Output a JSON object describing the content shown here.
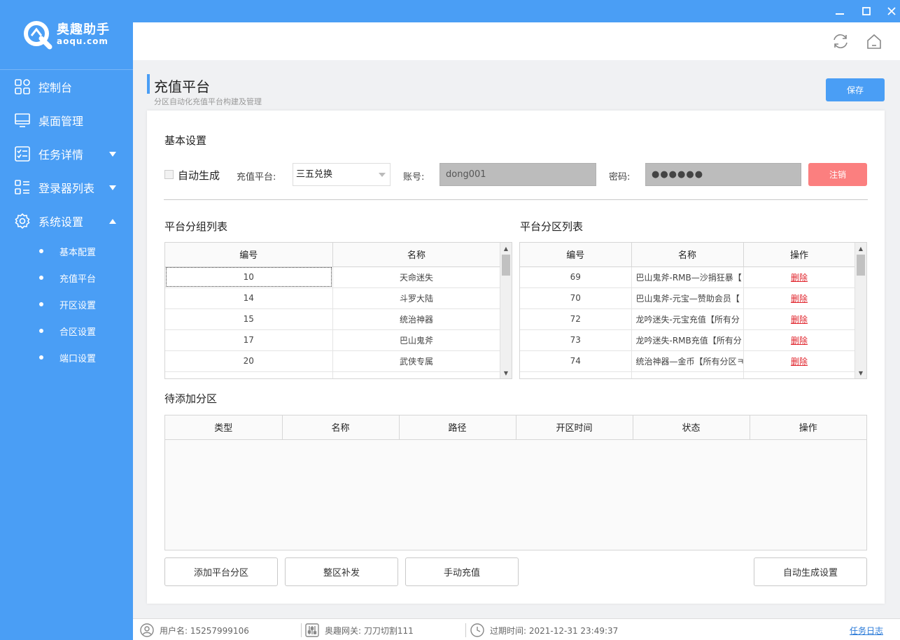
{
  "app": {
    "logo_cn": "奥趣助手",
    "logo_en": "aoqu.com",
    "brand_color": "#4a9ef5"
  },
  "sidebar": {
    "items": [
      {
        "label": "控制台",
        "icon": "grid-icon"
      },
      {
        "label": "桌面管理",
        "icon": "monitor-icon"
      },
      {
        "label": "任务详情",
        "icon": "checklist-icon",
        "expand": "down"
      },
      {
        "label": "登录器列表",
        "icon": "list-icon",
        "expand": "down"
      },
      {
        "label": "系统设置",
        "icon": "gear-icon",
        "expand": "up"
      }
    ],
    "sub_items": [
      "基本配置",
      "充值平台",
      "开区设置",
      "合区设置",
      "端口设置"
    ]
  },
  "window": {
    "min": "─",
    "max": "☐",
    "close": "✕"
  },
  "page": {
    "title": "充值平台",
    "subtitle": "分区自动化充值平台构建及管理",
    "save_label": "保存"
  },
  "basic": {
    "section_title": "基本设置",
    "auto_generate_label": "自动生成",
    "platform_label": "充值平台:",
    "platform_value": "三五兑换",
    "account_label": "账号:",
    "account_value": "dong001",
    "password_label": "密码:",
    "password_value": "●●●●●●",
    "cancel_label": "注销",
    "cancel_color": "#fb7f7f"
  },
  "group_table": {
    "title": "平台分组列表",
    "columns": [
      "编号",
      "名称"
    ],
    "rows": [
      [
        "10",
        "天命迷失"
      ],
      [
        "14",
        "斗罗大陆"
      ],
      [
        "15",
        "统治神器"
      ],
      [
        "17",
        "巴山鬼斧"
      ],
      [
        "20",
        "武侠专属"
      ]
    ]
  },
  "zone_table": {
    "title": "平台分区列表",
    "columns": [
      "编号",
      "名称",
      "操作"
    ],
    "delete_label": "删除",
    "rows": [
      [
        "69",
        "巴山鬼斧-RMB—沙捐狂暴【"
      ],
      [
        "70",
        "巴山鬼斧-元宝—赞助会员【"
      ],
      [
        "72",
        "龙吟迷失-元宝充值【所有分"
      ],
      [
        "73",
        "龙吟迷失-RMB充值【所有分"
      ],
      [
        "74",
        "统治神器—金币【所有分区ㅋ"
      ]
    ]
  },
  "pending_table": {
    "title": "待添加分区",
    "columns": [
      "类型",
      "名称",
      "路径",
      "开区时间",
      "状态",
      "操作"
    ]
  },
  "actions": {
    "add_zone": "添加平台分区",
    "full_reissue": "整区补发",
    "manual_recharge": "手动充值",
    "auto_settings": "自动生成设置"
  },
  "status": {
    "user": "用户名: 15257999106",
    "gateway": "奥趣网关: 刀刀切割111",
    "expire": "过期时间: 2021-12-31 23:49:37",
    "task_log": "任务日志"
  }
}
